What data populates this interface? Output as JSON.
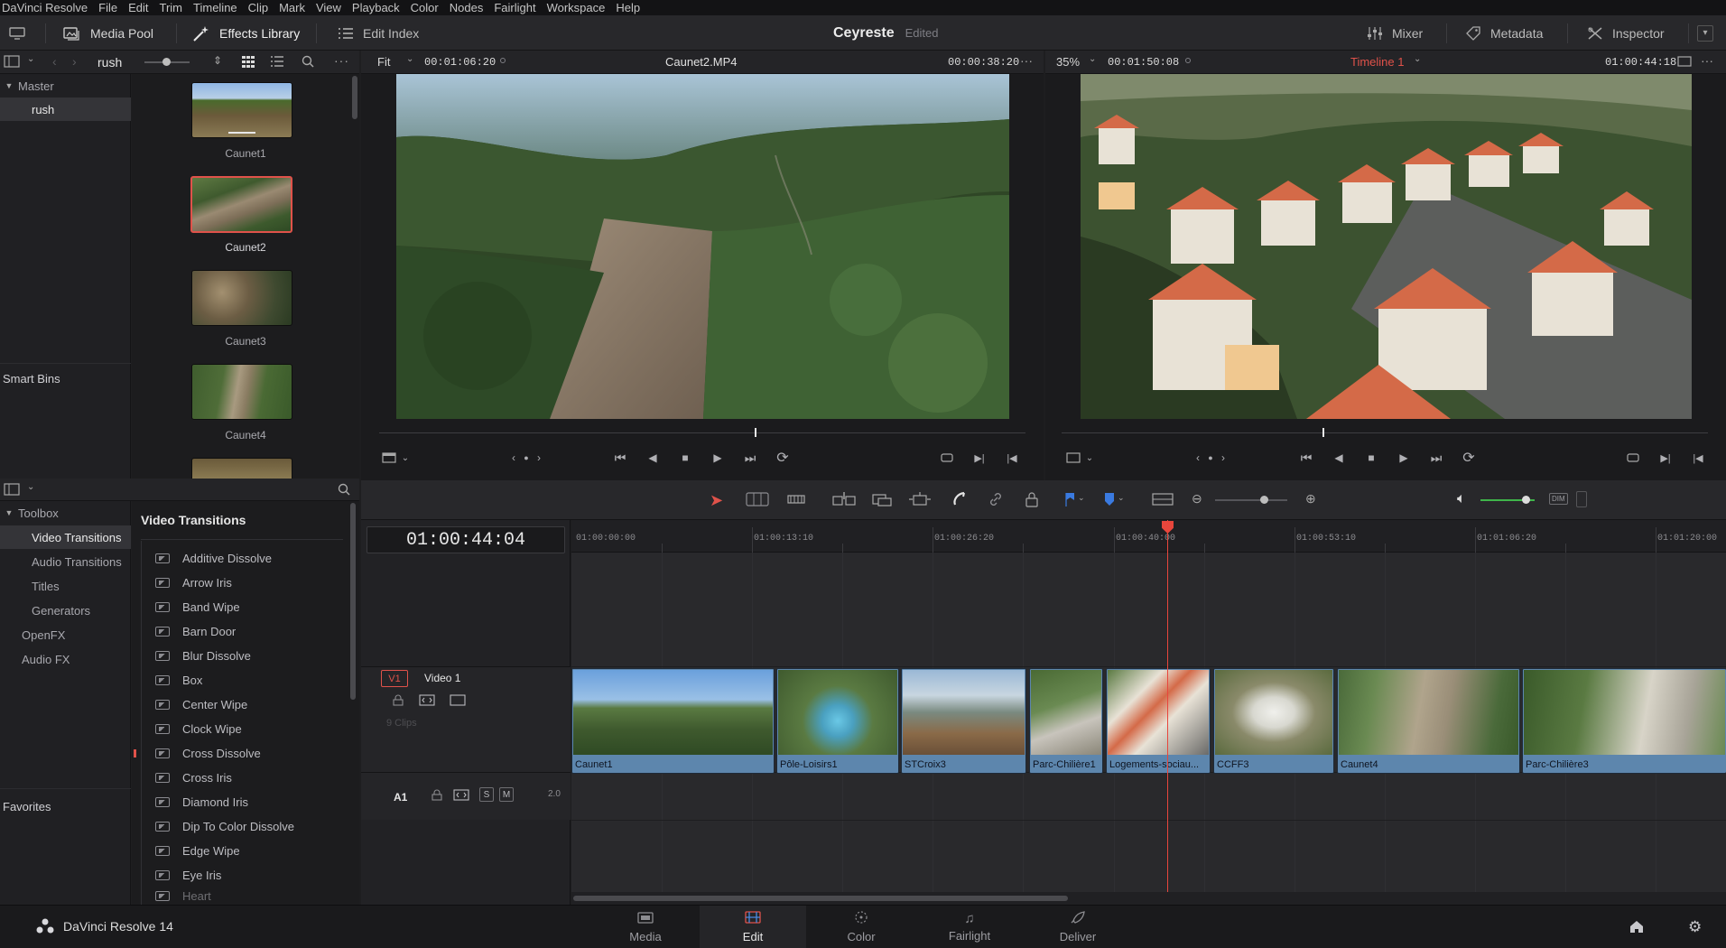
{
  "menubar": [
    "DaVinci Resolve",
    "File",
    "Edit",
    "Trim",
    "Timeline",
    "Clip",
    "Mark",
    "View",
    "Playback",
    "Color",
    "Nodes",
    "Fairlight",
    "Workspace",
    "Help"
  ],
  "toolbar": {
    "media_pool": "Media Pool",
    "effects_library": "Effects Library",
    "edit_index": "Edit Index",
    "project_name": "Ceyreste",
    "project_status": "Edited",
    "mixer": "Mixer",
    "metadata": "Metadata",
    "inspector": "Inspector"
  },
  "media_pool": {
    "bin_name": "rush",
    "bins": {
      "master": "Master",
      "rush": "rush",
      "smart_bins": "Smart Bins"
    },
    "clips": [
      "Caunet1",
      "Caunet2",
      "Caunet3",
      "Caunet4"
    ]
  },
  "source_viewer": {
    "zoom": "Fit",
    "timecode": "00:01:06:20",
    "clip_name": "Caunet2.MP4",
    "duration": "00:00:38:20"
  },
  "timeline_viewer": {
    "zoom": "35%",
    "timecode": "00:01:50:08",
    "timeline_name": "Timeline 1",
    "duration": "01:00:44:18"
  },
  "effects": {
    "toolbox": "Toolbox",
    "categories": [
      "Video Transitions",
      "Audio Transitions",
      "Titles",
      "Generators"
    ],
    "openfx": "OpenFX",
    "audio_fx": "Audio FX",
    "favorites": "Favorites",
    "list_title": "Video Transitions",
    "transitions": [
      "Additive Dissolve",
      "Arrow Iris",
      "Band Wipe",
      "Barn Door",
      "Blur Dissolve",
      "Box",
      "Center Wipe",
      "Clock Wipe",
      "Cross Dissolve",
      "Cross Iris",
      "Diamond Iris",
      "Dip To Color Dissolve",
      "Edge Wipe",
      "Eye Iris",
      "Heart"
    ]
  },
  "timeline": {
    "timecode": "01:00:44:04",
    "ruler": [
      "01:00:00:00",
      "01:00:13:10",
      "01:00:26:20",
      "01:00:40:00",
      "01:00:53:10",
      "01:01:06:20",
      "01:01:20:00"
    ],
    "video_track": {
      "id": "V1",
      "name": "Video 1",
      "clip_count": "9 Clips"
    },
    "audio_track": {
      "id": "A1",
      "solo": "S",
      "mute": "M",
      "channels": "2.0"
    },
    "clips": [
      "Caunet1",
      "Pôle-Loisirs1",
      "STCroix3",
      "Parc-Chilière1",
      "Logements-sociau...",
      "CCFF3",
      "Caunet4",
      "Parc-Chilière3"
    ]
  },
  "footer": {
    "app_name": "DaVinci Resolve 14",
    "pages": [
      "Media",
      "Edit",
      "Color",
      "Fairlight",
      "Deliver"
    ],
    "active_page": "Edit"
  },
  "colors": {
    "accent_red": "#e0524a",
    "clip_blue": "#5d86ad",
    "playhead": "#e8463c",
    "timeline_name": "#e0524a",
    "audio_green": "#3fb54a"
  }
}
